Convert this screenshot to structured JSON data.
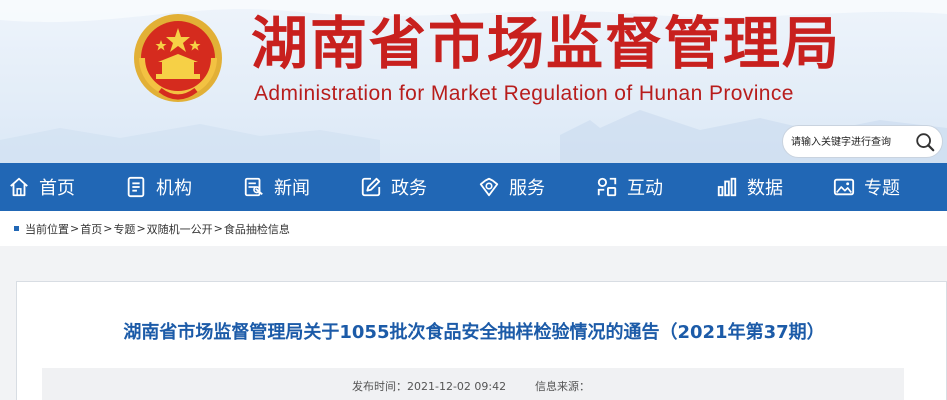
{
  "header": {
    "title": "湖南省市场监督管理局",
    "subtitle": "Administration for Market Regulation of Hunan Province",
    "emblem_icon": "national-emblem-icon",
    "colors": {
      "title_red": "#c8201e",
      "nav_blue": "#2167b5"
    }
  },
  "search": {
    "placeholder": "请输入关键字进行查询",
    "icon": "search-icon"
  },
  "nav": {
    "items": [
      {
        "label": "首页",
        "icon": "home-icon"
      },
      {
        "label": "机构",
        "icon": "organization-icon"
      },
      {
        "label": "新闻",
        "icon": "news-icon"
      },
      {
        "label": "政务",
        "icon": "edit-icon"
      },
      {
        "label": "服务",
        "icon": "service-icon"
      },
      {
        "label": "互动",
        "icon": "interaction-icon"
      },
      {
        "label": "数据",
        "icon": "data-chart-icon"
      },
      {
        "label": "专题",
        "icon": "image-icon"
      }
    ]
  },
  "breadcrumb": {
    "current_label": "当前位置",
    "items": [
      "首页",
      "专题",
      "双随机一公开",
      "食品抽检信息"
    ]
  },
  "article": {
    "title": "湖南省市场监督管理局关于1055批次食品安全抽样检验情况的通告（2021年第37期）",
    "published_label": "发布时间：",
    "published_value": "2021-12-02 09:42",
    "source_label": "信息来源："
  }
}
